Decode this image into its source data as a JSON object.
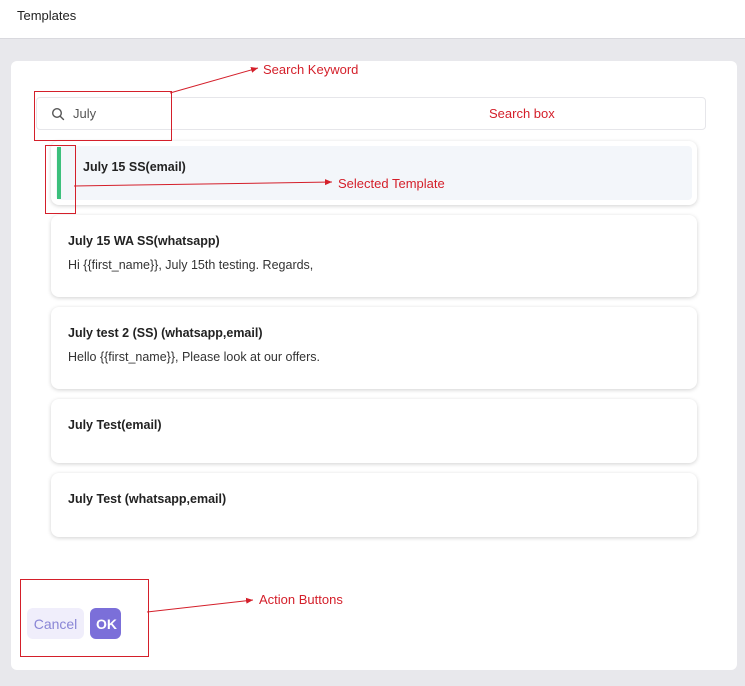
{
  "header": {
    "title": "Templates"
  },
  "search": {
    "value": "July",
    "placeholder": ""
  },
  "templates": [
    {
      "name": "July 15 SS(email)",
      "body": ""
    },
    {
      "name": "July 15 WA SS(whatsapp)",
      "body": "Hi {{first_name}}, July 15th testing. Regards,"
    },
    {
      "name": "July test 2 (SS) (whatsapp,email)",
      "body": "Hello {{first_name}}, Please look at our offers."
    },
    {
      "name": "July Test(email)",
      "body": ""
    },
    {
      "name": "July Test (whatsapp,email)",
      "body": ""
    }
  ],
  "actions": {
    "cancel_label": "Cancel",
    "ok_label": "OK"
  },
  "annotations": {
    "search_keyword": "Search Keyword",
    "search_box": "Search box",
    "selected_template": "Selected Template",
    "action_buttons": "Action Buttons"
  },
  "colors": {
    "annotation": "#d41f2a",
    "selected_bar": "#3cc07c",
    "primary": "#7b6fd9",
    "cancel_bg": "#f0eefb"
  }
}
